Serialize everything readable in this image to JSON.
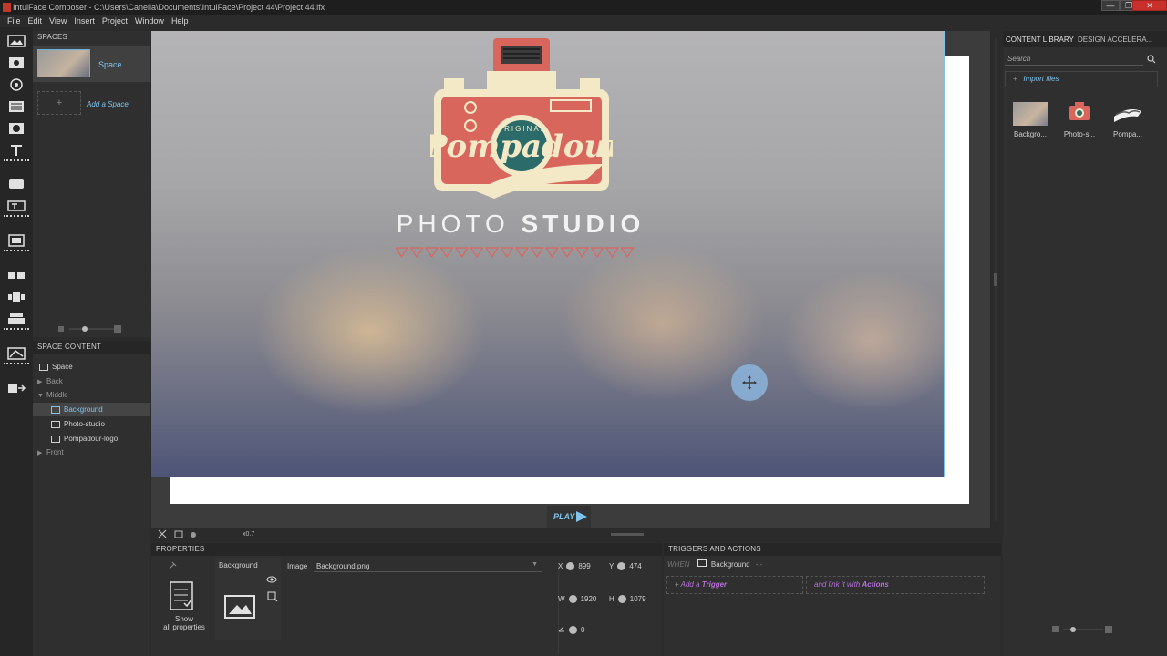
{
  "window": {
    "title": "IntuiFace Composer - C:\\Users\\Canella\\Documents\\IntuiFace\\Project 44\\Project 44.ifx",
    "minimize": "—",
    "maximize": "❐",
    "close": "✕"
  },
  "menu": [
    "File",
    "Edit",
    "View",
    "Insert",
    "Project",
    "Window",
    "Help"
  ],
  "spaces_panel": {
    "title": "SPACES",
    "items": [
      {
        "label": "Space"
      }
    ],
    "add_label": "Add a Space",
    "add_symbol": "+"
  },
  "space_content": {
    "title": "SPACE CONTENT",
    "rows": [
      {
        "label": "Space",
        "kind": "space"
      },
      {
        "label": "Back",
        "kind": "layer"
      },
      {
        "label": "Middle",
        "kind": "layer-open"
      },
      {
        "label": "Background",
        "kind": "image",
        "selected": true
      },
      {
        "label": "Photo-studio",
        "kind": "image"
      },
      {
        "label": "Pompadour-logo",
        "kind": "image"
      },
      {
        "label": "Front",
        "kind": "layer"
      }
    ]
  },
  "stage": {
    "logo_small": "ORIGINAL",
    "logo_script": "Pompadour",
    "studio_light": "PHOTO",
    "studio_bold": "STUDIO",
    "play_label": "PLAY",
    "zoom_label": "x0.7",
    "colors": {
      "logo_red": "#d9665d",
      "logo_cream": "#f3e9c6",
      "logo_teal": "#2b6b6a",
      "selection": "#7fc4ee"
    }
  },
  "properties": {
    "title": "PROPERTIES",
    "element_name": "Background",
    "show_all": "Show",
    "show_all_2": "all properties",
    "image_label": "Image",
    "image_value": "Background.png",
    "x_label": "X",
    "x_value": "899",
    "y_label": "Y",
    "y_value": "474",
    "w_label": "W",
    "w_value": "1920",
    "h_label": "H",
    "h_value": "1079",
    "angle_value": "0"
  },
  "triggers": {
    "title": "TRIGGERS AND ACTIONS",
    "when_label": "WHEN",
    "when_target": "Background",
    "when_suffix": "- -",
    "add_trigger_prefix": "Add a",
    "add_trigger_word": "Trigger",
    "link_prefix": "and link it with",
    "link_word": "Actions"
  },
  "right_panel": {
    "tab_library": "CONTENT LIBRARY",
    "tab_design": "DESIGN ACCELERA...",
    "search_placeholder": "Search",
    "import_label": "Import files",
    "items": [
      {
        "label": "Backgro..."
      },
      {
        "label": "Photo-s..."
      },
      {
        "label": "Pompa..."
      }
    ]
  }
}
